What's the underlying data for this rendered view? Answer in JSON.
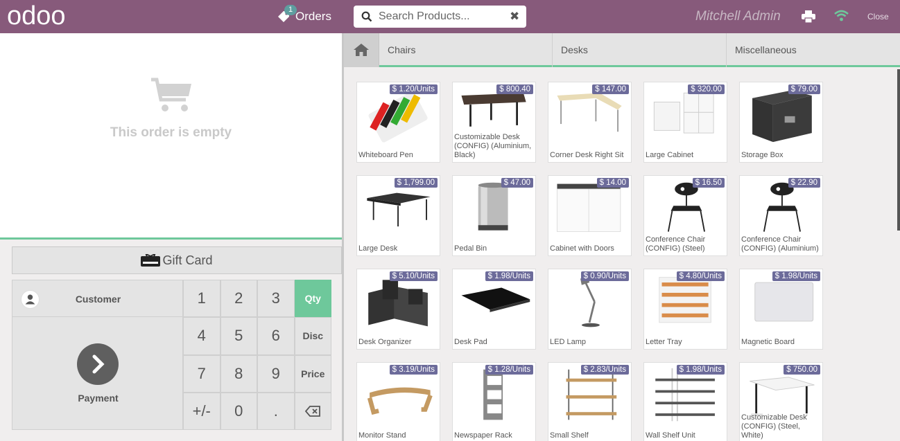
{
  "header": {
    "logo_text": "odoo",
    "orders_label": "Orders",
    "orders_count": "1",
    "search_placeholder": "Search Products...",
    "user_name": "Mitchell Admin",
    "close_label": "Close",
    "accent_color": "#875a7b"
  },
  "order": {
    "empty_text": "This order is empty"
  },
  "giftcard_label": "Gift Card",
  "numpad": {
    "customer_label": "Customer",
    "payment_label": "Payment",
    "keys": [
      "1",
      "2",
      "3",
      "Qty",
      "4",
      "5",
      "6",
      "Disc",
      "7",
      "8",
      "9",
      "Price",
      "+/-",
      "0",
      ".",
      "⌫"
    ],
    "active_mode": "Qty"
  },
  "categories": [
    "Chairs",
    "Desks",
    "Miscellaneous"
  ],
  "products": [
    {
      "name": "Whiteboard Pen",
      "price": "$ 1.20/Units",
      "icon": "whiteboard-pen"
    },
    {
      "name": "Customizable Desk (CONFIG) (Aluminium, Black)",
      "price": "$ 800.40",
      "icon": "desk"
    },
    {
      "name": "Corner Desk Right Sit",
      "price": "$ 147.00",
      "icon": "corner-desk"
    },
    {
      "name": "Large Cabinet",
      "price": "$ 320.00",
      "icon": "cabinet"
    },
    {
      "name": "Storage Box",
      "price": "$ 79.00",
      "icon": "storage-box"
    },
    {
      "name": "Large Desk",
      "price": "$ 1,799.00",
      "icon": "large-desk"
    },
    {
      "name": "Pedal Bin",
      "price": "$ 47.00",
      "icon": "pedal-bin"
    },
    {
      "name": "Cabinet with Doors",
      "price": "$ 14.00",
      "icon": "cabinet-doors"
    },
    {
      "name": "Conference Chair (CONFIG) (Steel)",
      "price": "$ 16.50",
      "icon": "chair"
    },
    {
      "name": "Conference Chair (CONFIG) (Aluminium)",
      "price": "$ 22.90",
      "icon": "chair"
    },
    {
      "name": "Desk Organizer",
      "price": "$ 5.10/Units",
      "icon": "organizer"
    },
    {
      "name": "Desk Pad",
      "price": "$ 1.98/Units",
      "icon": "desk-pad"
    },
    {
      "name": "LED Lamp",
      "price": "$ 0.90/Units",
      "icon": "lamp"
    },
    {
      "name": "Letter Tray",
      "price": "$ 4.80/Units",
      "icon": "letter-tray"
    },
    {
      "name": "Magnetic Board",
      "price": "$ 1.98/Units",
      "icon": "board"
    },
    {
      "name": "Monitor Stand",
      "price": "$ 3.19/Units",
      "icon": "monitor-stand"
    },
    {
      "name": "Newspaper Rack",
      "price": "$ 1.28/Units",
      "icon": "rack"
    },
    {
      "name": "Small Shelf",
      "price": "$ 2.83/Units",
      "icon": "small-shelf"
    },
    {
      "name": "Wall Shelf Unit",
      "price": "$ 1.98/Units",
      "icon": "wall-shelf"
    },
    {
      "name": "Customizable Desk (CONFIG) (Steel, White)",
      "price": "$ 750.00",
      "icon": "desk-white"
    }
  ]
}
